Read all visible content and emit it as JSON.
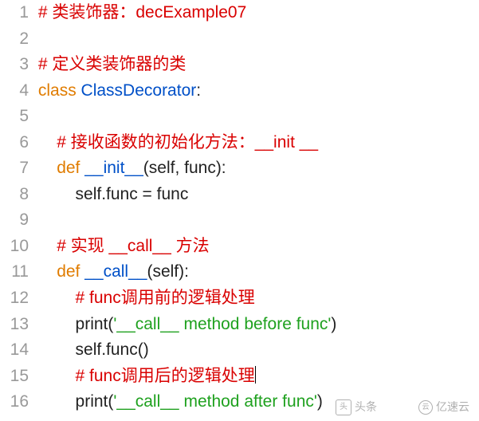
{
  "lines": [
    {
      "num": "1",
      "tokens": [
        [
          "cmt",
          "# 类装饰器：decExample07"
        ]
      ]
    },
    {
      "num": "2",
      "tokens": []
    },
    {
      "num": "3",
      "tokens": [
        [
          "cmt",
          "# 定义类装饰器的类"
        ]
      ]
    },
    {
      "num": "4",
      "tokens": [
        [
          "kw",
          "class "
        ],
        [
          "cls",
          "ClassDecorator"
        ],
        [
          "punc",
          ":"
        ]
      ]
    },
    {
      "num": "5",
      "tokens": []
    },
    {
      "num": "6",
      "tokens": [
        [
          "punc",
          "    "
        ],
        [
          "cmt",
          "# 接收函数的初始化方法：__init __"
        ]
      ]
    },
    {
      "num": "7",
      "tokens": [
        [
          "punc",
          "    "
        ],
        [
          "kw",
          "def "
        ],
        [
          "fn",
          "__init__"
        ],
        [
          "punc",
          "(self, func):"
        ]
      ]
    },
    {
      "num": "8",
      "tokens": [
        [
          "punc",
          "        self.func = func"
        ]
      ]
    },
    {
      "num": "9",
      "tokens": []
    },
    {
      "num": "10",
      "tokens": [
        [
          "punc",
          "    "
        ],
        [
          "cmt",
          "# 实现 __call__ 方法"
        ]
      ]
    },
    {
      "num": "11",
      "tokens": [
        [
          "punc",
          "    "
        ],
        [
          "kw",
          "def "
        ],
        [
          "fn",
          "__call__"
        ],
        [
          "punc",
          "(self):"
        ]
      ]
    },
    {
      "num": "12",
      "tokens": [
        [
          "punc",
          "        "
        ],
        [
          "cmt",
          "# func调用前的逻辑处理"
        ]
      ]
    },
    {
      "num": "13",
      "tokens": [
        [
          "punc",
          "        print("
        ],
        [
          "str",
          "'__call__ method before func'"
        ],
        [
          "punc",
          ")"
        ]
      ]
    },
    {
      "num": "14",
      "tokens": [
        [
          "punc",
          "        self.func()"
        ]
      ]
    },
    {
      "num": "15",
      "tokens": [
        [
          "punc",
          "        "
        ],
        [
          "cmt",
          "# func调用后的逻辑处理"
        ],
        [
          "cursor",
          ""
        ]
      ]
    },
    {
      "num": "16",
      "tokens": [
        [
          "punc",
          "        print("
        ],
        [
          "str",
          "'__call__ method after func'"
        ],
        [
          "punc",
          ")"
        ]
      ]
    }
  ],
  "watermark_left_text": "头条",
  "watermark_right_text": "亿速云"
}
